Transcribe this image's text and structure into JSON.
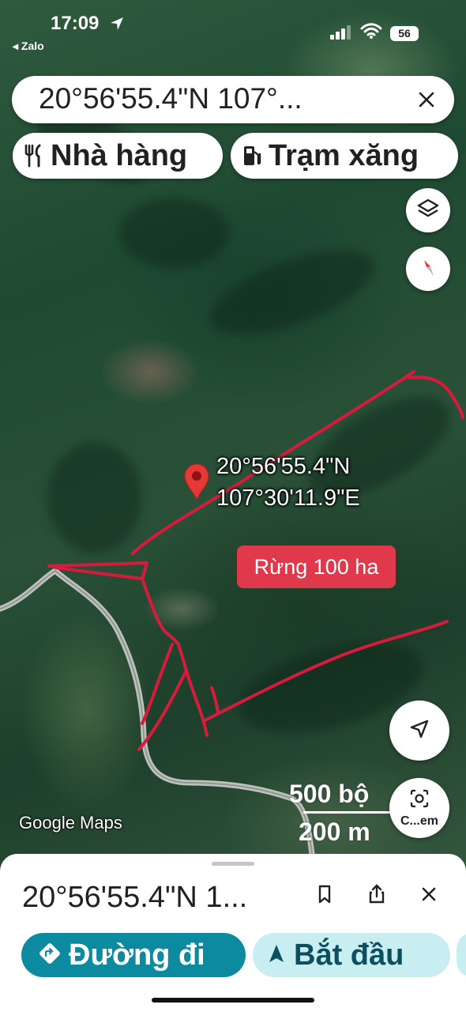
{
  "status_bar": {
    "time": "17:09",
    "back_app": "◂ Zalo",
    "battery": "56"
  },
  "search": {
    "query": "20°56'55.4\"N 107°..."
  },
  "chips": [
    {
      "label": "Nhà hàng",
      "icon": "fork-knife-icon"
    },
    {
      "label": "Trạm xăng",
      "icon": "gas-station-icon"
    }
  ],
  "map": {
    "pin_label_line1": "20°56'55.4\"N",
    "pin_label_line2": "107°30'11.9\"E",
    "annotation": "Rừng 100 ha",
    "attribution": "Google Maps",
    "scale_imperial": "500 bộ",
    "scale_metric": "200 m",
    "camera_label": "C...em",
    "colors": {
      "pin": "#e53935",
      "boundary_lines": "#d81b3c",
      "annotation_bg": "#e0394b"
    }
  },
  "sheet": {
    "title": "20°56'55.4\"N 1...",
    "directions_label": "Đường đi",
    "start_label": "Bắt đầu",
    "accent": "#0b8aa0"
  }
}
